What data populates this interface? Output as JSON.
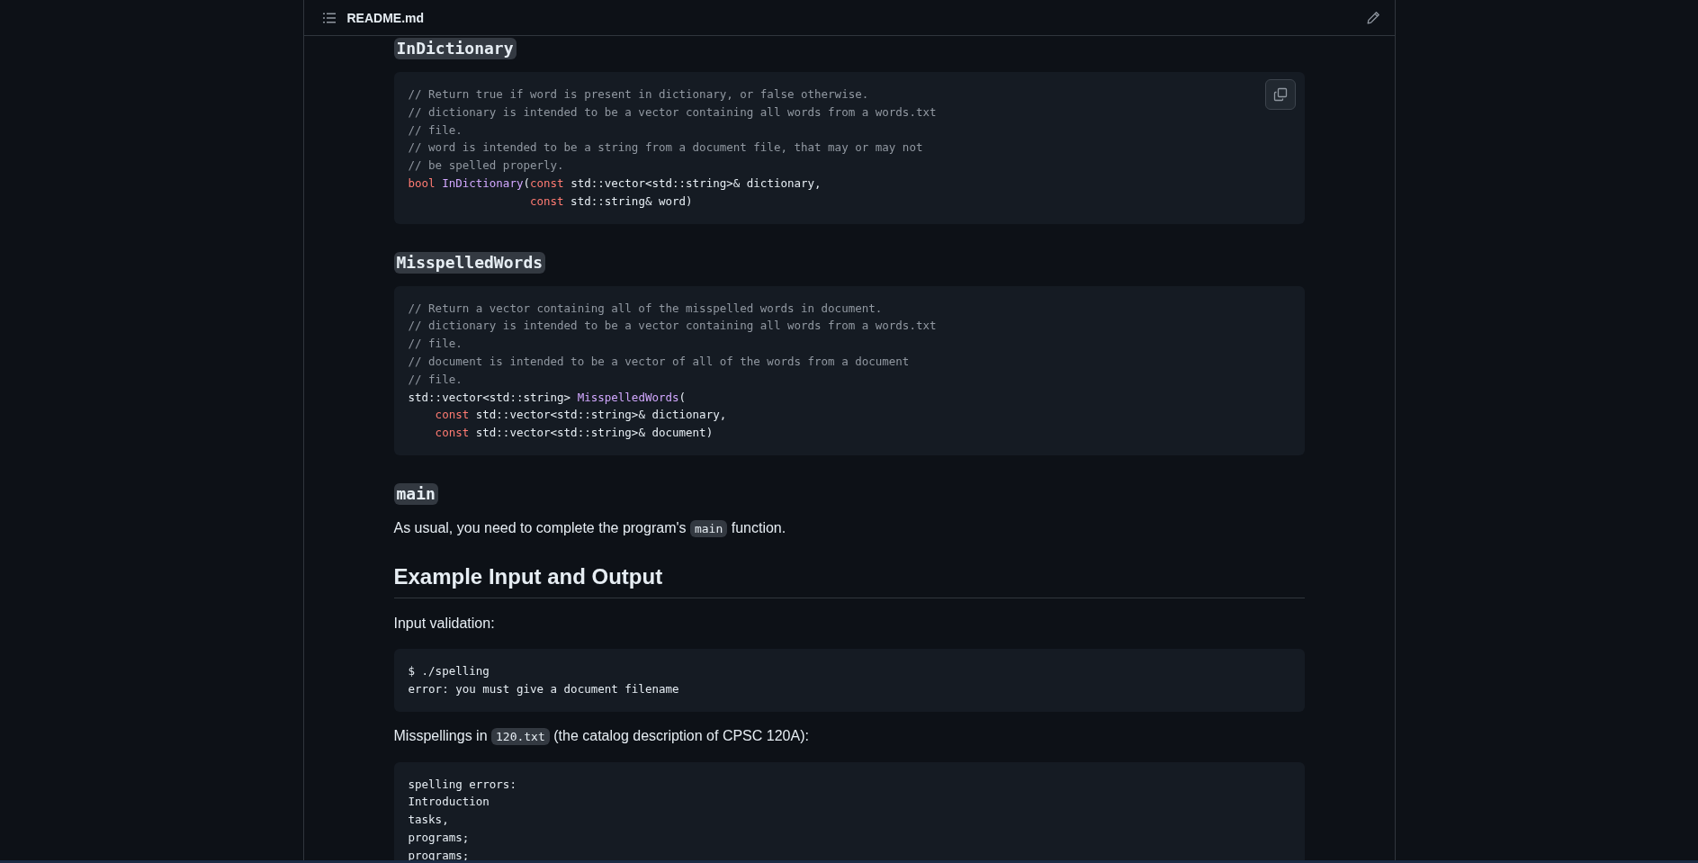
{
  "header": {
    "filename": "README.md"
  },
  "blocks": [
    {
      "kind": "code_heading",
      "text": "InDictionary"
    },
    {
      "kind": "code",
      "copy_button": true,
      "lines": [
        [
          {
            "kind": "comment",
            "text": "// Return true if word is present in dictionary, or false otherwise."
          }
        ],
        [
          {
            "kind": "comment",
            "text": "// dictionary is intended to be a vector containing all words from a words.txt"
          }
        ],
        [
          {
            "kind": "comment",
            "text": "// file."
          }
        ],
        [
          {
            "kind": "comment",
            "text": "// word is intended to be a string from a document file, that may or may not"
          }
        ],
        [
          {
            "kind": "comment",
            "text": "// be spelled properly."
          }
        ],
        [
          {
            "kind": "keyword",
            "text": "bool"
          },
          {
            "kind": "function",
            "text": " InDictionary"
          },
          {
            "kind": "plain",
            "text": "("
          },
          {
            "kind": "keyword",
            "text": "const"
          },
          {
            "kind": "plain",
            "text": " std::vector<std::string>& dictionary,"
          }
        ],
        [
          {
            "kind": "keyword",
            "text": "                  const"
          },
          {
            "kind": "plain",
            "text": " std::string& word)"
          }
        ]
      ]
    },
    {
      "kind": "code_heading",
      "text": "MisspelledWords"
    },
    {
      "kind": "code",
      "lines": [
        [
          {
            "kind": "comment",
            "text": "// Return a vector containing all of the misspelled words in document."
          }
        ],
        [
          {
            "kind": "comment",
            "text": "// dictionary is intended to be a vector containing all words from a words.txt"
          }
        ],
        [
          {
            "kind": "comment",
            "text": "// file."
          }
        ],
        [
          {
            "kind": "comment",
            "text": "// document is intended to be a vector of all of the words from a document"
          }
        ],
        [
          {
            "kind": "comment",
            "text": "// file."
          }
        ],
        [
          {
            "kind": "plain",
            "text": "std::vector<std::string> "
          },
          {
            "kind": "function",
            "text": "MisspelledWords"
          },
          {
            "kind": "plain",
            "text": "("
          }
        ],
        [
          {
            "kind": "keyword",
            "text": "    const"
          },
          {
            "kind": "plain",
            "text": " std::vector<std::string>& dictionary,"
          }
        ],
        [
          {
            "kind": "keyword",
            "text": "    const"
          },
          {
            "kind": "plain",
            "text": " std::vector<std::string>& document)"
          }
        ]
      ]
    },
    {
      "kind": "code_heading",
      "text": "main"
    },
    {
      "kind": "paragraph",
      "parts": [
        {
          "kind": "text",
          "text": "As usual, you need to complete the program's "
        },
        {
          "kind": "code",
          "text": "main"
        },
        {
          "kind": "text",
          "text": " function."
        }
      ]
    },
    {
      "kind": "heading",
      "text": "Example Input and Output"
    },
    {
      "kind": "paragraph",
      "parts": [
        {
          "kind": "text",
          "text": "Input validation:"
        }
      ]
    },
    {
      "kind": "code",
      "lines": [
        [
          {
            "kind": "plain",
            "text": "$ ./spelling"
          }
        ],
        [
          {
            "kind": "plain",
            "text": "error: you must give a document filename"
          }
        ]
      ]
    },
    {
      "kind": "paragraph",
      "parts": [
        {
          "kind": "text",
          "text": "Misspellings in "
        },
        {
          "kind": "code",
          "text": "120.txt"
        },
        {
          "kind": "text",
          "text": " (the catalog description of CPSC 120A):"
        }
      ]
    },
    {
      "kind": "code",
      "lines": [
        [
          {
            "kind": "plain",
            "text": "spelling errors:"
          }
        ],
        [
          {
            "kind": "plain",
            "text": "Introduction"
          }
        ],
        [
          {
            "kind": "plain",
            "text": "tasks,"
          }
        ],
        [
          {
            "kind": "plain",
            "text": "programs;"
          }
        ],
        [
          {
            "kind": "plain",
            "text": "programs;"
          }
        ]
      ]
    }
  ]
}
